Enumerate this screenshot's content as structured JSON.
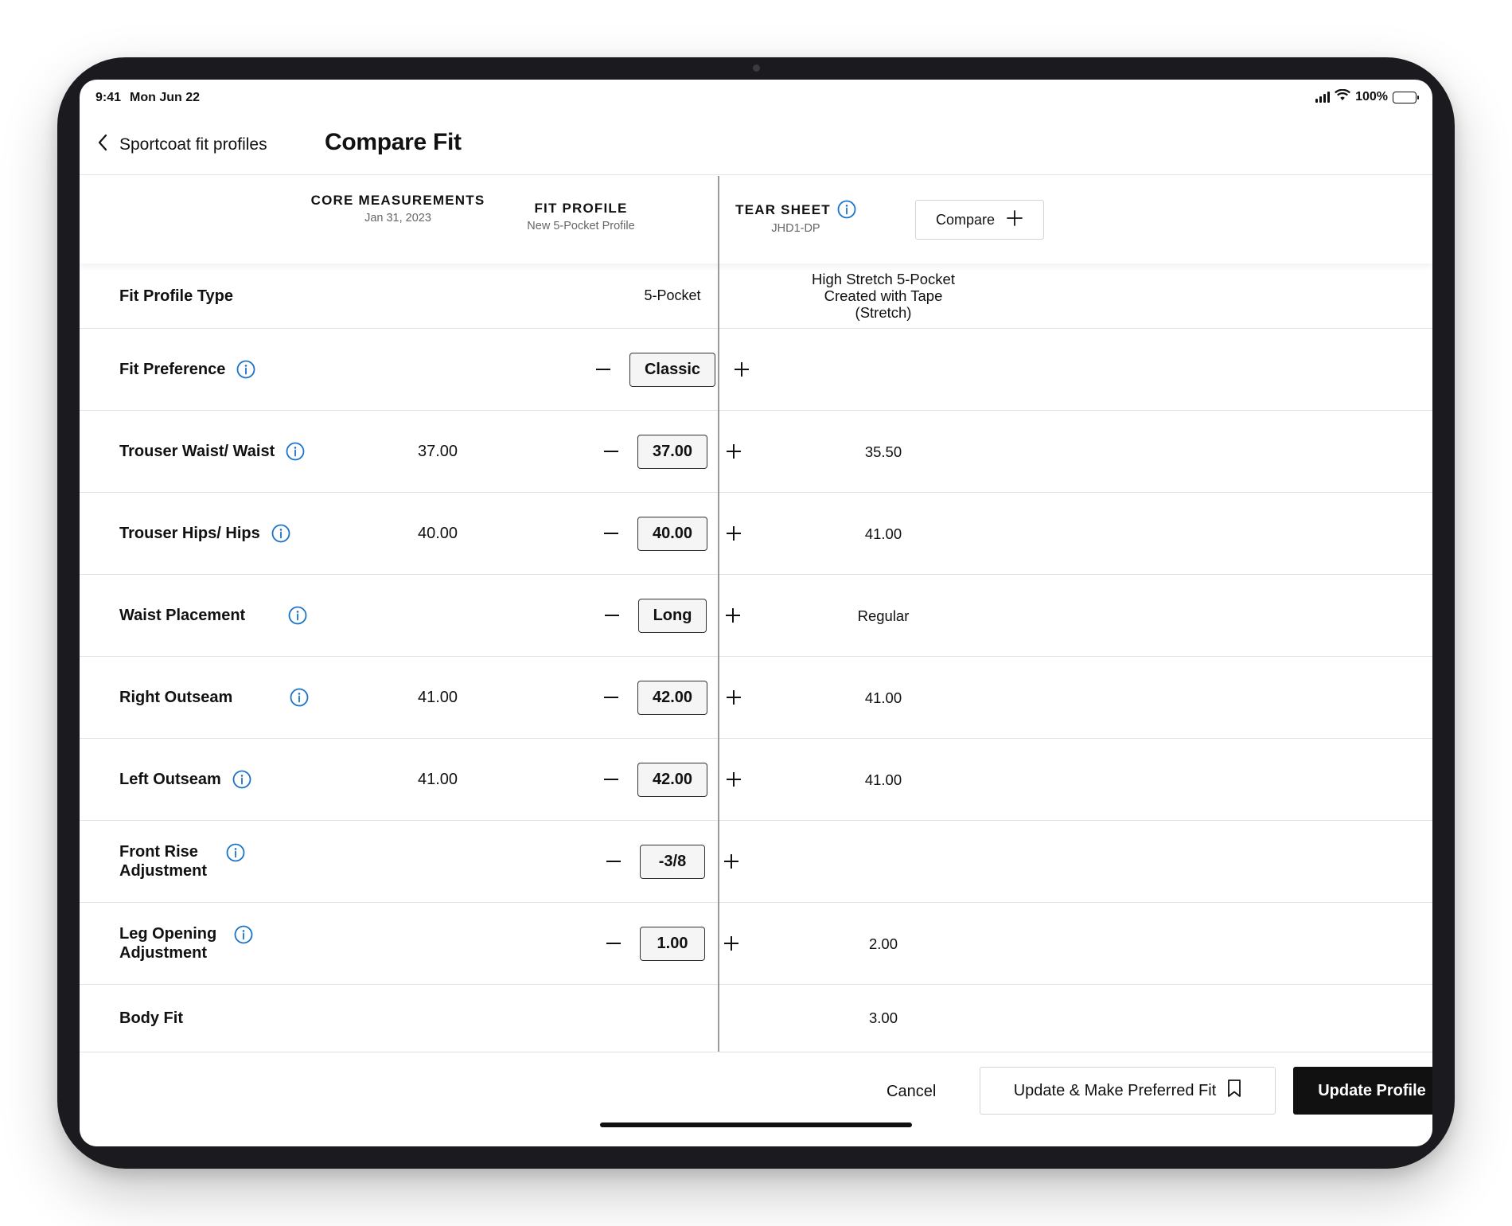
{
  "status": {
    "time": "9:41",
    "date": "Mon Jun 22",
    "battery": "100%"
  },
  "nav": {
    "back_label": "Sportcoat fit profiles",
    "title": "Compare Fit"
  },
  "columns": {
    "core": {
      "title": "CORE MEASUREMENTS",
      "subtitle": "Jan 31, 2023"
    },
    "fit": {
      "title": "FIT PROFILE",
      "subtitle": "New 5-Pocket Profile"
    },
    "tear": {
      "title": "TEAR SHEET",
      "subtitle": "JHD1-DP"
    },
    "compare_label": "Compare"
  },
  "rows": [
    {
      "label": "Fit Profile Type",
      "core": "",
      "fit": "5-Pocket",
      "tear": "High Stretch 5-Pocket Created with Tape (Stretch)"
    },
    {
      "label": "Fit Preference",
      "core": "",
      "fit": "Classic",
      "tear": ""
    },
    {
      "label": "Trouser Waist/ Waist",
      "core": "37.00",
      "fit": "37.00",
      "tear": "35.50"
    },
    {
      "label": "Trouser Hips/ Hips",
      "core": "40.00",
      "fit": "40.00",
      "tear": "41.00"
    },
    {
      "label": "Waist Placement",
      "core": "",
      "fit": "Long",
      "tear": "Regular"
    },
    {
      "label": "Right Outseam",
      "core": "41.00",
      "fit": "42.00",
      "tear": "41.00"
    },
    {
      "label": "Left Outseam",
      "core": "41.00",
      "fit": "42.00",
      "tear": "41.00"
    },
    {
      "label": "Front Rise Adjustment",
      "core": "",
      "fit": "-3/8",
      "tear": ""
    },
    {
      "label": "Leg Opening Adjustment",
      "core": "",
      "fit": "1.00",
      "tear": "2.00"
    },
    {
      "label": "Body Fit",
      "core": "",
      "fit": "",
      "tear": "3.00"
    }
  ],
  "footer": {
    "cancel_label": "Cancel",
    "preferred_label": "Update & Make Preferred Fit",
    "update_label": "Update Profile"
  },
  "colors": {
    "accent": "#1a73c8",
    "primary_button": "#111111"
  }
}
